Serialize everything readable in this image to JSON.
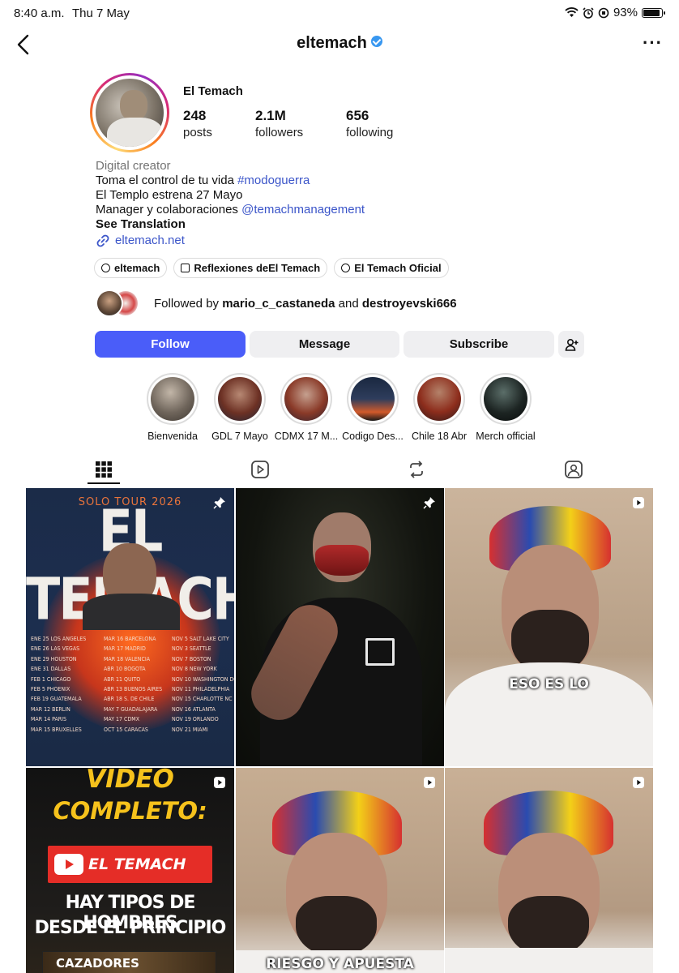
{
  "status_bar": {
    "time": "8:40 a.m.",
    "date": "Thu 7 May",
    "battery": "93%",
    "battery_level": 0.93
  },
  "header": {
    "username": "eltemach"
  },
  "profile": {
    "full_name": "El Temach",
    "stats": [
      {
        "number": "248",
        "label": "posts"
      },
      {
        "number": "2.1M",
        "label": "followers"
      },
      {
        "number": "656",
        "label": "following"
      }
    ],
    "category": "Digital creator",
    "bio_line1_text": "Toma el control de tu vida ",
    "bio_line1_hashtag": "#modoguerra",
    "bio_line2": "El Templo estrena 27 Mayo",
    "bio_line3_text": "Manager y colaboraciones ",
    "bio_line3_mention": "@temachmanagement",
    "see_translation": "See Translation",
    "link": "eltemach.net"
  },
  "chips": [
    {
      "label": "eltemach",
      "icon": "threads-icon"
    },
    {
      "label": "Reflexiones deEl Temach",
      "icon": "channel-icon"
    },
    {
      "label": "El Temach Oficial",
      "icon": "facebook-icon"
    }
  ],
  "followed_by": {
    "prefix": "Followed by ",
    "user1": "mario_c_castaneda",
    "joiner": " and ",
    "user2": "destroyevski666"
  },
  "buttons": {
    "follow": "Follow",
    "message": "Message",
    "subscribe": "Subscribe"
  },
  "highlights": [
    {
      "label": "Bienvenida"
    },
    {
      "label": "GDL 7 Mayo"
    },
    {
      "label": "CDMX 17 M..."
    },
    {
      "label": "Codigo Des..."
    },
    {
      "label": "Chile 18 Abr"
    },
    {
      "label": "Merch official"
    }
  ],
  "tabs": [
    "grid-icon",
    "reels-icon",
    "reposts-icon",
    "tagged-icon"
  ],
  "posts": {
    "p1_tour": "SOLO TOUR 2026",
    "p1_title": "EL TEMACH",
    "p3_caption": "ESO ES LO",
    "p4_line1": "VIDEO",
    "p4_line2": "COMPLETO:",
    "p4_channel": "EL TEMACH",
    "p4_line3": "HAY TIPOS DE HOMBRES",
    "p4_line4": "DESDE EL PRINCIPIO",
    "p4_line5": "CAZADORES",
    "p5_caption": "RIESGO Y APUESTA"
  },
  "tour_dates_col1": [
    "ENE 25 LOS ANGELES",
    "ENE 26 LAS VEGAS",
    "ENE 29 HOUSTON",
    "ENE 31 DALLAS",
    "FEB 1 CHICAGO",
    "FEB 5 PHOENIX",
    "FEB 19 GUATEMALA",
    "MAR 12 BERLIN",
    "MAR 14 PARIS",
    "MAR 15 BRUXELLES"
  ],
  "tour_dates_col2": [
    "MAR 16 BARCELONA",
    "MAR 17 MADRID",
    "MAR 18 VALENCIA",
    "ABR 10 BOGOTA",
    "ABR 11 QUITO",
    "ABR 13 BUENOS AIRES",
    "ABR 18 S. DE CHILE",
    "MAY 7 GUADALAJARA",
    "MAY 17 CDMX",
    "OCT 15 CARACAS"
  ],
  "tour_dates_col3": [
    "NOV 5 SALT LAKE CITY",
    "NOV 3 SEATTLE",
    "NOV 7 BOSTON",
    "NOV 8 NEW YORK",
    "NOV 10 WASHINGTON DC",
    "NOV 11 PHILADELPHIA",
    "NOV 15 CHARLOTTE NC",
    "NOV 16 ATLANTA",
    "NOV 19 ORLANDO",
    "NOV 21 MIAMI"
  ],
  "colors": {
    "accent": "#4a5df9",
    "link": "#3b55c9",
    "video_red": "#e52d27",
    "yellow_text": "#f6c21c"
  }
}
